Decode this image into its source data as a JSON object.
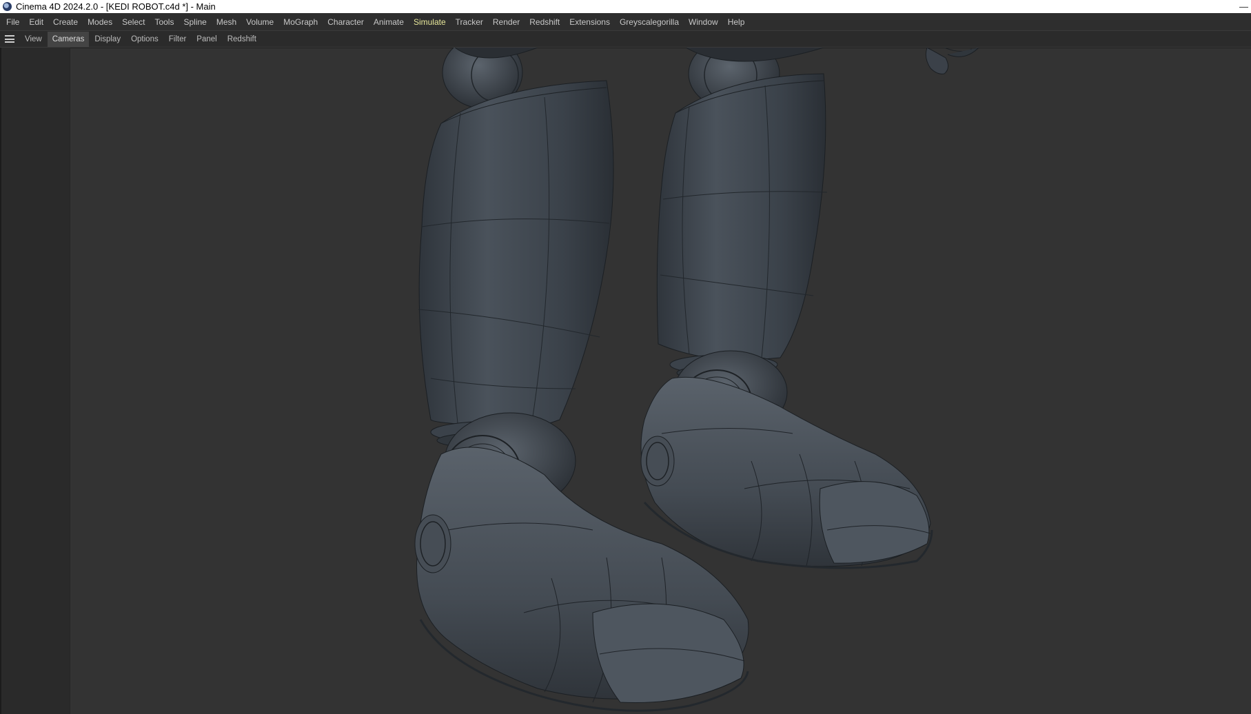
{
  "window": {
    "title": "Cinema 4D 2024.2.0 - [KEDI ROBOT.c4d *] - Main",
    "minimize_glyph": "—",
    "app_icon": "cinema4d-logo-icon"
  },
  "menubar": {
    "items": [
      {
        "label": "File"
      },
      {
        "label": "Edit"
      },
      {
        "label": "Create"
      },
      {
        "label": "Modes"
      },
      {
        "label": "Select"
      },
      {
        "label": "Tools"
      },
      {
        "label": "Spline"
      },
      {
        "label": "Mesh"
      },
      {
        "label": "Volume"
      },
      {
        "label": "MoGraph"
      },
      {
        "label": "Character"
      },
      {
        "label": "Animate"
      },
      {
        "label": "Simulate"
      },
      {
        "label": "Tracker"
      },
      {
        "label": "Render"
      },
      {
        "label": "Redshift"
      },
      {
        "label": "Extensions"
      },
      {
        "label": "Greyscalegorilla"
      },
      {
        "label": "Window"
      },
      {
        "label": "Help"
      }
    ],
    "highlight_color": "#e7e79a"
  },
  "viewbar": {
    "menu_icon": "hamburger-icon",
    "items": [
      {
        "label": "View"
      },
      {
        "label": "Cameras"
      },
      {
        "label": "Display"
      },
      {
        "label": "Options"
      },
      {
        "label": "Filter"
      },
      {
        "label": "Panel"
      },
      {
        "label": "Redshift"
      }
    ],
    "selected": "Cameras"
  },
  "viewport": {
    "background": "#333333",
    "content": "robot-legs-wireframe-model"
  }
}
